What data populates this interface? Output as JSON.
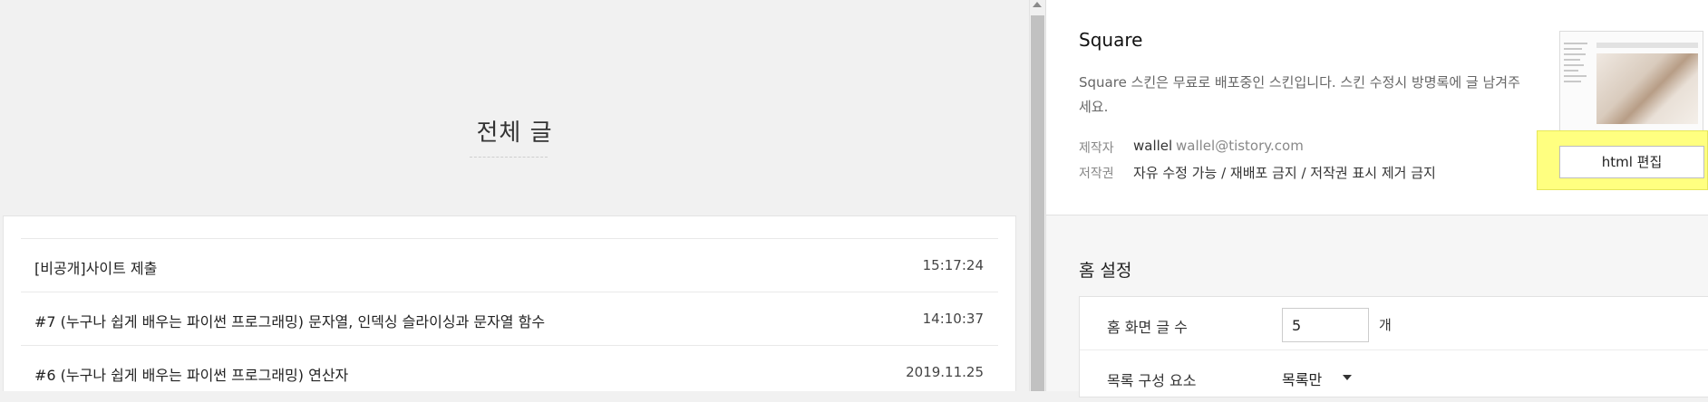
{
  "preview": {
    "page_title": "전체 글",
    "posts": [
      {
        "title": "[비공개]사이트 제출",
        "date": "15:17:24"
      },
      {
        "title": "#7 (누구나 쉽게 배우는 파이썬 프로그래밍) 문자열, 인덱싱 슬라이싱과 문자열 함수",
        "date": "14:10:37"
      },
      {
        "title": "#6 (누구나 쉽게 배우는 파이썬 프로그래밍) 연산자",
        "date": "2019.11.25"
      }
    ]
  },
  "skin": {
    "name": "Square",
    "description": "Square 스킨은 무료로 배포중인 스킨입니다. 스킨 수정시 방명록에 글 남겨주세요.",
    "author_label": "제작자",
    "author_name": "wallel",
    "author_email": "wallel@tistory.com",
    "license_label": "저작권",
    "license_value": "자유 수정 가능 / 재배포 금지 / 저작권 표시 제거 금지",
    "html_edit_label": "html 편집",
    "highlight_color": "#ffff80"
  },
  "home_settings": {
    "section_title": "홈 설정",
    "post_count_label": "홈 화면 글 수",
    "post_count_value": "5",
    "post_count_unit": "개",
    "list_components_label": "목록 구성 요소",
    "list_components_value": "목록만"
  }
}
